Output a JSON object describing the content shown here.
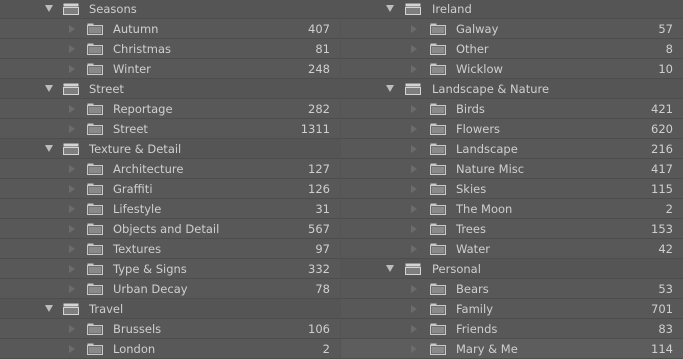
{
  "left": [
    {
      "type": "group",
      "name": "Seasons",
      "count": ""
    },
    {
      "type": "item",
      "name": "Autumn",
      "count": "407"
    },
    {
      "type": "item",
      "name": "Christmas",
      "count": "81"
    },
    {
      "type": "item",
      "name": "Winter",
      "count": "248"
    },
    {
      "type": "group",
      "name": "Street",
      "count": ""
    },
    {
      "type": "item",
      "name": "Reportage",
      "count": "282"
    },
    {
      "type": "item",
      "name": "Street",
      "count": "1311"
    },
    {
      "type": "group",
      "name": "Texture & Detail",
      "count": ""
    },
    {
      "type": "item",
      "name": "Architecture",
      "count": "127"
    },
    {
      "type": "item",
      "name": "Graffiti",
      "count": "126"
    },
    {
      "type": "item",
      "name": "Lifestyle",
      "count": "31"
    },
    {
      "type": "item",
      "name": "Objects and Detail",
      "count": "567"
    },
    {
      "type": "item",
      "name": "Textures",
      "count": "97"
    },
    {
      "type": "item",
      "name": "Type & Signs",
      "count": "332"
    },
    {
      "type": "item",
      "name": "Urban Decay",
      "count": "78"
    },
    {
      "type": "group",
      "name": "Travel",
      "count": ""
    },
    {
      "type": "item",
      "name": "Brussels",
      "count": "106"
    },
    {
      "type": "item",
      "name": "London",
      "count": "2"
    }
  ],
  "right": [
    {
      "type": "group",
      "name": "Ireland",
      "count": ""
    },
    {
      "type": "item",
      "name": "Galway",
      "count": "57"
    },
    {
      "type": "item",
      "name": "Other",
      "count": "8"
    },
    {
      "type": "item",
      "name": "Wicklow",
      "count": "10"
    },
    {
      "type": "group",
      "name": "Landscape & Nature",
      "count": ""
    },
    {
      "type": "item",
      "name": "Birds",
      "count": "421"
    },
    {
      "type": "item",
      "name": "Flowers",
      "count": "620"
    },
    {
      "type": "item",
      "name": "Landscape",
      "count": "216"
    },
    {
      "type": "item",
      "name": "Nature Misc",
      "count": "417"
    },
    {
      "type": "item",
      "name": "Skies",
      "count": "115"
    },
    {
      "type": "item",
      "name": "The Moon",
      "count": "2"
    },
    {
      "type": "item",
      "name": "Trees",
      "count": "153"
    },
    {
      "type": "item",
      "name": "Water",
      "count": "42"
    },
    {
      "type": "group",
      "name": "Personal",
      "count": ""
    },
    {
      "type": "item",
      "name": "Bears",
      "count": "53"
    },
    {
      "type": "item",
      "name": "Family",
      "count": "701"
    },
    {
      "type": "item",
      "name": "Friends",
      "count": "83"
    },
    {
      "type": "item",
      "name": "Mary & Me",
      "count": "114"
    }
  ],
  "colors": {
    "background": "#545454",
    "text": "#cfcfcf",
    "folder": "#c9c9c9"
  },
  "icons": {
    "group": "collection-set-icon",
    "item": "collection-folder-icon",
    "expand": "disclosure-triangle-icon"
  }
}
